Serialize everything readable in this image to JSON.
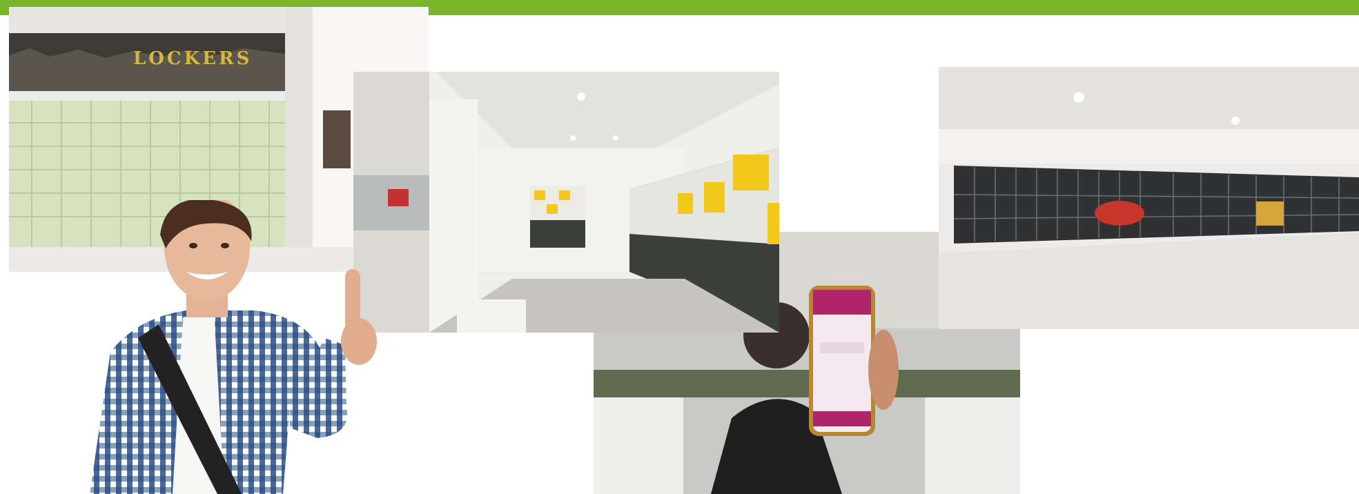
{
  "header": {
    "accent_color": "#79b42a"
  },
  "photos": {
    "lockers_wall": {
      "sign_text": "LOCKERS",
      "locker_color": "#d8e6c4"
    },
    "corridor": {
      "locker_colors": [
        "#f2c81a",
        "#e9e9e4",
        "#3d3f3b"
      ]
    },
    "long_locker_wall": {
      "frame_color": "#2f3133",
      "scooter_color": "#c8352a"
    },
    "phone": {
      "app_color": "#b0246a"
    },
    "person": {
      "shirt_pattern": "blue-white-check"
    }
  }
}
